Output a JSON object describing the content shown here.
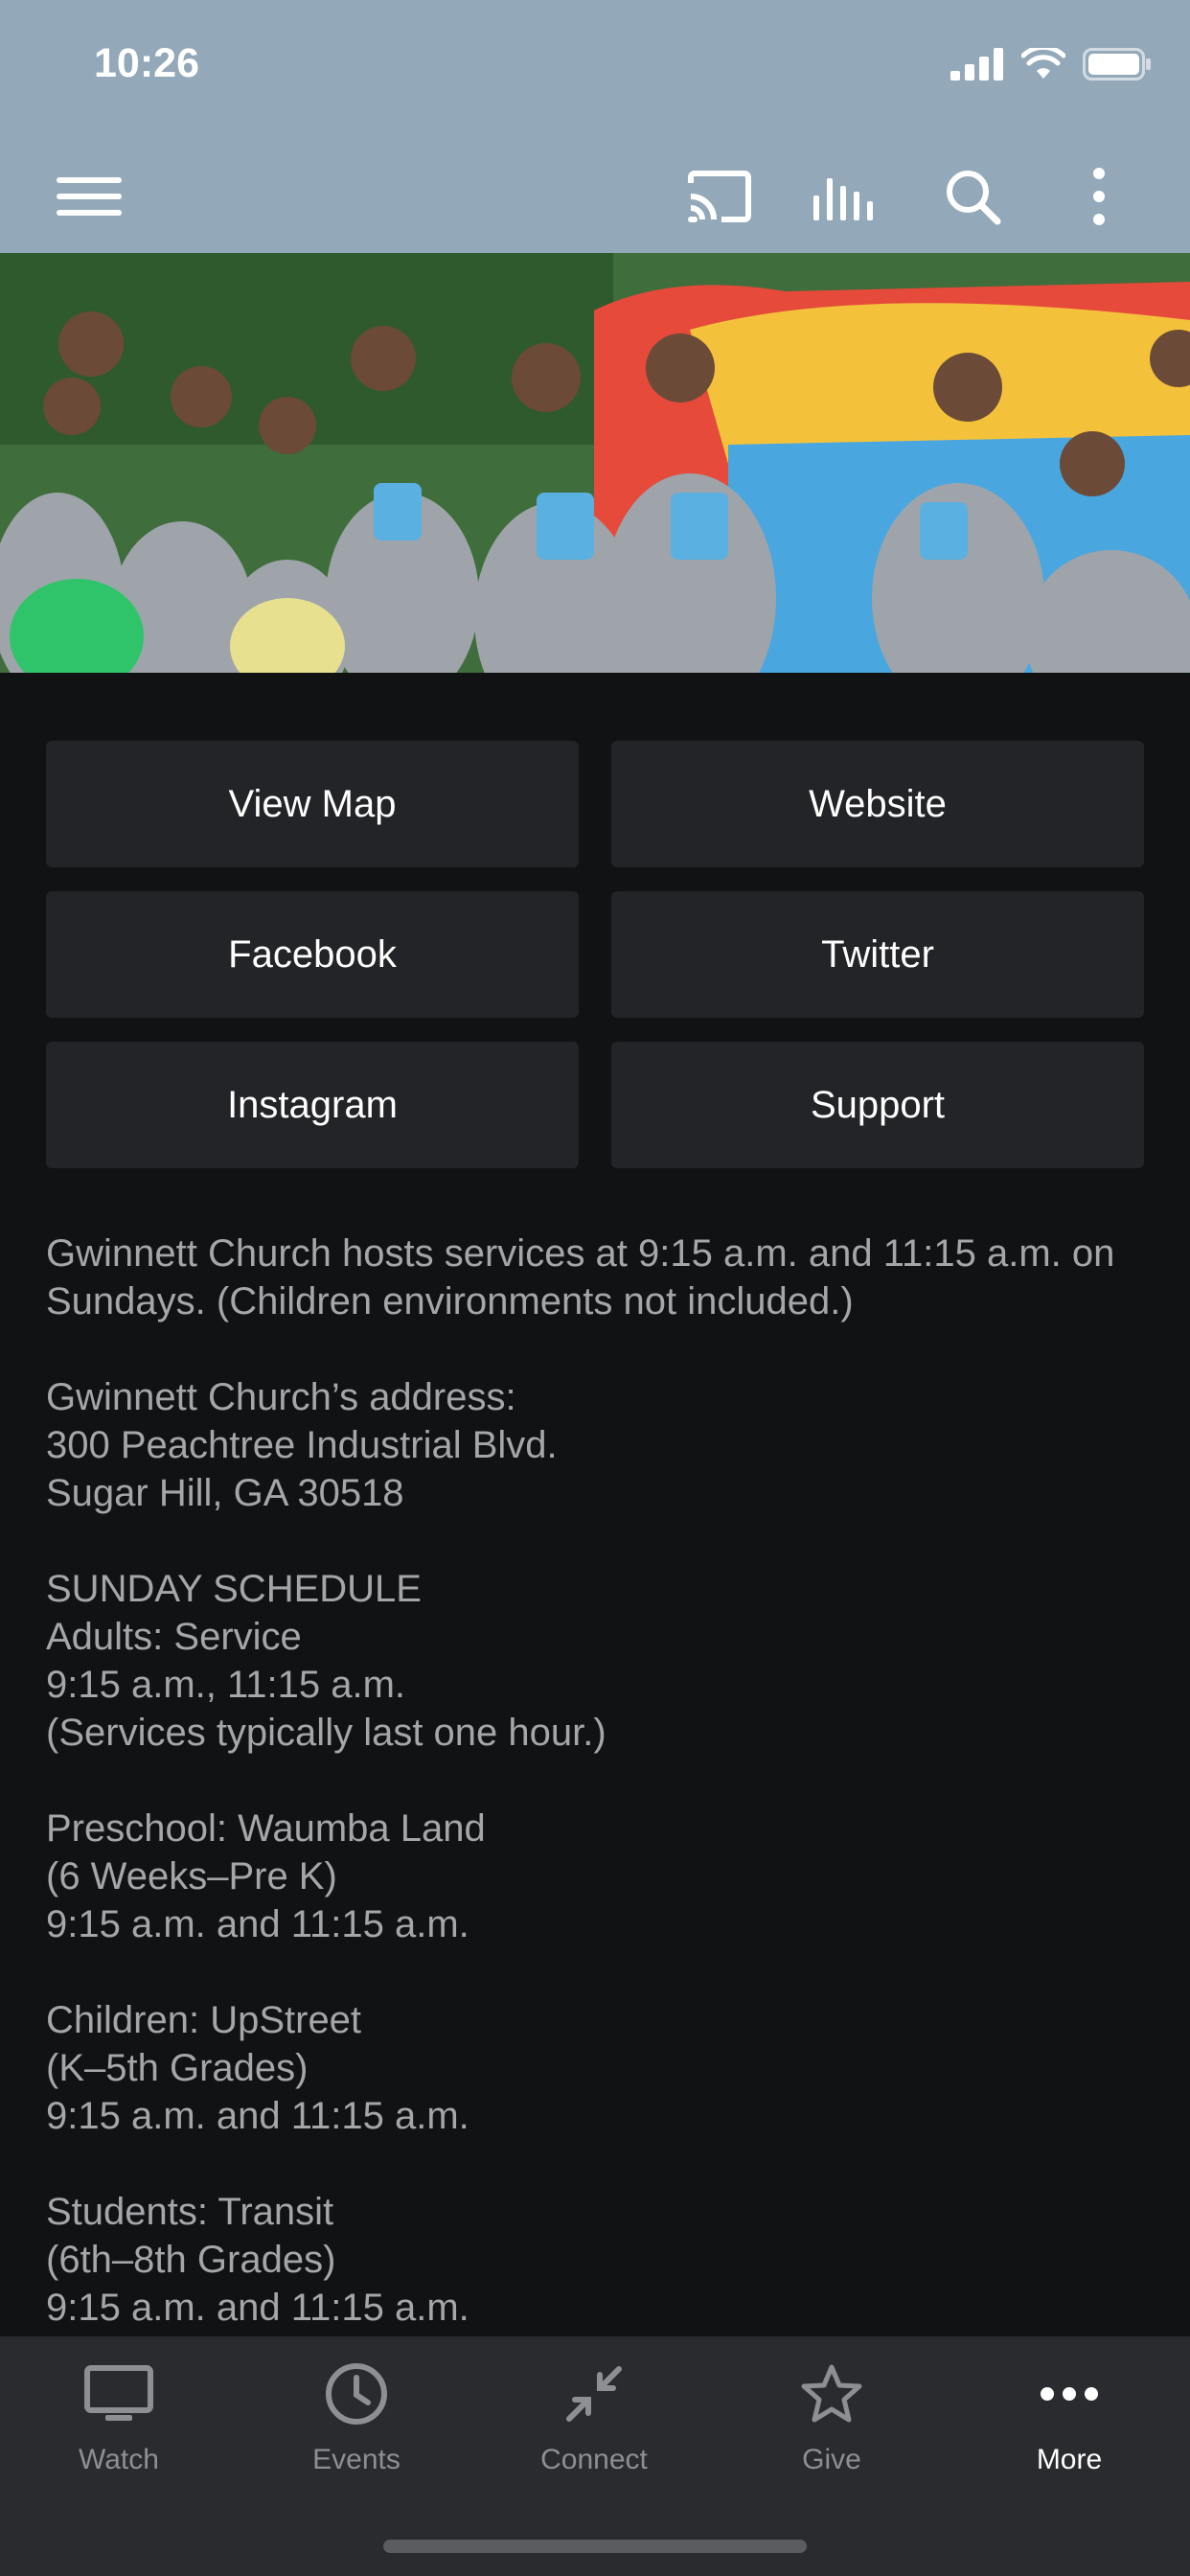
{
  "status_bar": {
    "time": "10:26"
  },
  "toolbar": {
    "icons": [
      "menu-icon",
      "cast-icon",
      "audio-bars-icon",
      "search-icon",
      "more-vertical-icon"
    ]
  },
  "links": [
    {
      "label": "View Map"
    },
    {
      "label": "Website"
    },
    {
      "label": "Facebook"
    },
    {
      "label": "Twitter"
    },
    {
      "label": "Instagram"
    },
    {
      "label": "Support"
    }
  ],
  "info_text": "Gwinnett Church hosts services at 9:15 a.m. and 11:15 a.m. on Sundays.  (Children environments not included.)\n\nGwinnett Church’s address:\n300 Peachtree Industrial Blvd.\nSugar Hill, GA 30518\n\nSUNDAY SCHEDULE\nAdults: Service\n9:15 a.m., 11:15 a.m.\n(Services typically last one hour.)\n\nPreschool: Waumba Land\n(6 Weeks–Pre K)\n9:15 a.m. and 11:15 a.m.\n\nChildren: UpStreet\n(K–5th Grades)\n9:15 a.m. and 11:15 a.m.\n\nStudents: Transit\n(6th–8th Grades)\n9:15 a.m. and 11:15 a.m.",
  "bottom_nav": {
    "items": [
      {
        "label": "Watch",
        "icon": "monitor-icon"
      },
      {
        "label": "Events",
        "icon": "clock-icon"
      },
      {
        "label": "Connect",
        "icon": "compress-arrows-icon"
      },
      {
        "label": "Give",
        "icon": "star-icon"
      },
      {
        "label": "More",
        "icon": "more-horizontal-icon",
        "active": true
      }
    ]
  },
  "colors": {
    "header": "#93a9ba",
    "background": "#111214",
    "button": "#232427",
    "nav": "#2a2b2e"
  }
}
